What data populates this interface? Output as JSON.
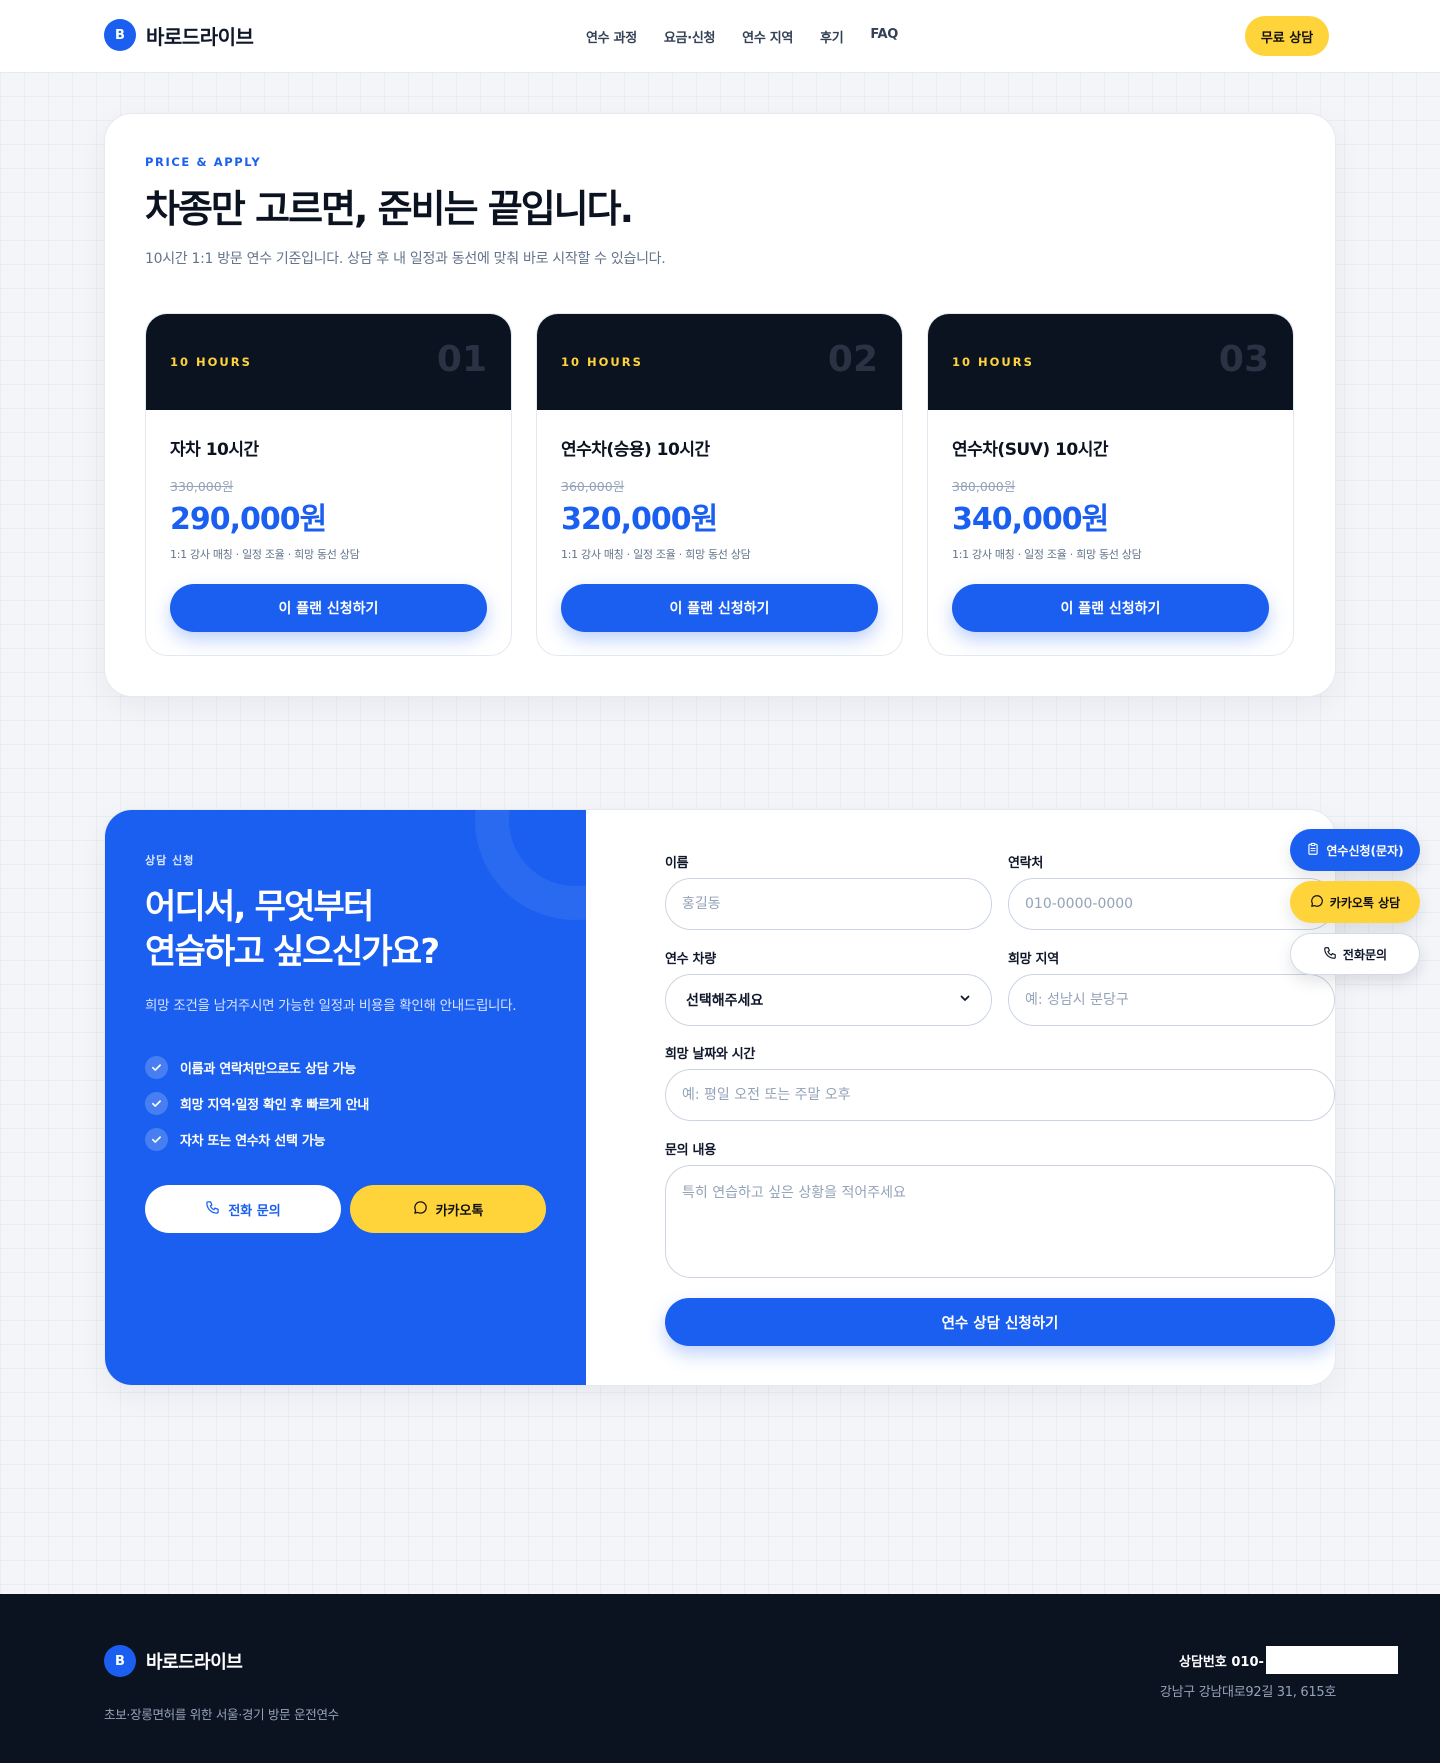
{
  "brand": {
    "logo_letter": "B",
    "name": "바로드라이브"
  },
  "nav": {
    "items": [
      "연수 과정",
      "요금·신청",
      "연수 지역",
      "후기",
      "FAQ"
    ],
    "cta": "무료 상담"
  },
  "pricing": {
    "eyebrow": "PRICE & APPLY",
    "title": "차종만 고르면, 준비는 끝입니다.",
    "subtitle": "10시간 1:1 방문 연수 기준입니다. 상담 후 내 일정과 동선에 맞춰 바로 시작할 수 있습니다.",
    "plans": [
      {
        "hours": "10 HOURS",
        "num": "01",
        "name": "자차 10시간",
        "old_price": "330,000원",
        "price": "290,000원",
        "desc": "1:1 강사 매칭 · 일정 조율 · 희망 동선 상담",
        "button": "이 플랜 신청하기"
      },
      {
        "hours": "10 HOURS",
        "num": "02",
        "name": "연수차(승용) 10시간",
        "old_price": "360,000원",
        "price": "320,000원",
        "desc": "1:1 강사 매칭 · 일정 조율 · 희망 동선 상담",
        "button": "이 플랜 신청하기"
      },
      {
        "hours": "10 HOURS",
        "num": "03",
        "name": "연수차(SUV) 10시간",
        "old_price": "380,000원",
        "price": "340,000원",
        "desc": "1:1 강사 매칭 · 일정 조율 · 희망 동선 상담",
        "button": "이 플랜 신청하기"
      }
    ]
  },
  "consult": {
    "eyebrow": "상담 신청",
    "title_line1": "어디서, 무엇부터",
    "title_line2": "연습하고 싶으신가요?",
    "subtitle": "희망 조건을 남겨주시면 가능한 일정과 비용을 확인해 안내드립니다.",
    "checks": [
      "이름과 연락처만으로도 상담 가능",
      "희망 지역·일정 확인 후 빠르게 안내",
      "자차 또는 연수차 선택 가능"
    ],
    "phone_button": "전화 문의",
    "kakao_button": "카카오톡"
  },
  "form": {
    "name_label": "이름",
    "name_placeholder": "홍길동",
    "contact_label": "연락처",
    "contact_placeholder": "010-0000-0000",
    "car_label": "연수 차량",
    "car_selected": "선택해주세요",
    "area_label": "희망 지역",
    "area_placeholder": "예: 성남시 분당구",
    "datetime_label": "희망 날짜와 시간",
    "datetime_placeholder": "예: 평일 오전 또는 주말 오후",
    "message_label": "문의 내용",
    "message_placeholder": "특히 연습하고 싶은 상황을 적어주세요",
    "submit": "연수 상담 신청하기"
  },
  "floating": {
    "sms": "연수신청(문자)",
    "kakao": "카카오톡 상담",
    "call": "전화문의"
  },
  "footer": {
    "tagline": "초보·장롱면허를 위한 서울·경기 방문 운전연수",
    "contact_prefix": "상담번호 010-",
    "address": "강남구 강남대로92길 31, 615호"
  },
  "colors": {
    "primary": "#1a5ff0",
    "accent": "#ffd43b",
    "dark": "#0b1220"
  },
  "icons": [
    "check-icon",
    "phone-icon",
    "chat-bubble-icon",
    "clipboard-icon",
    "chevron-down-icon"
  ]
}
